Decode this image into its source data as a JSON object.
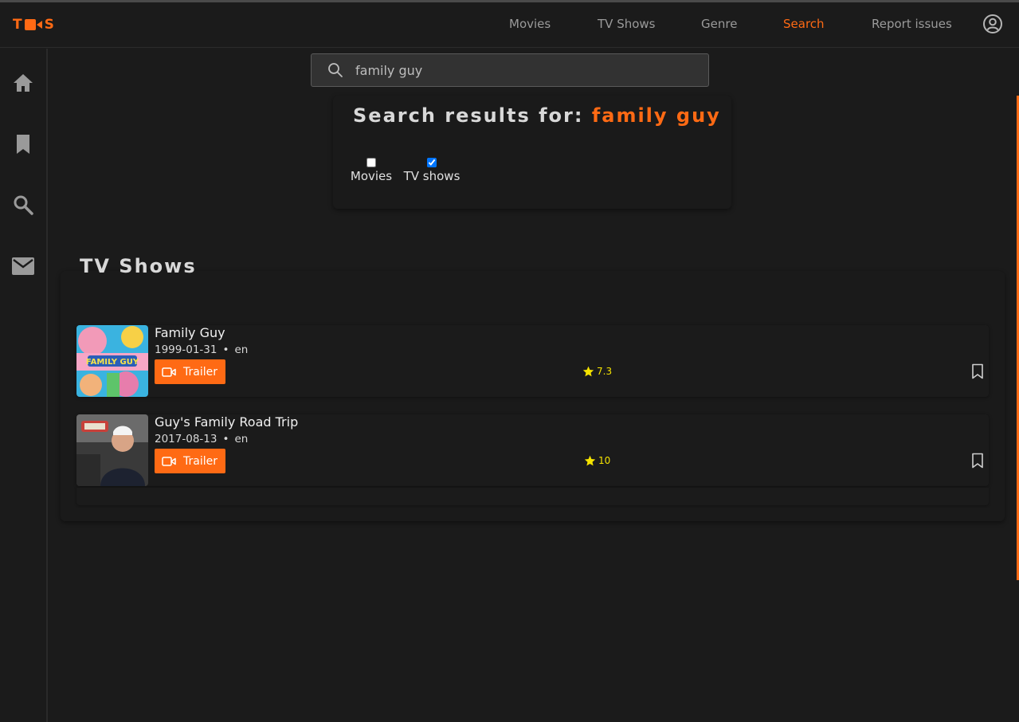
{
  "header": {
    "logo": {
      "left": "T",
      "right": "S",
      "icon": "camera-icon"
    },
    "nav": [
      {
        "label": "Movies",
        "active": false
      },
      {
        "label": "TV Shows",
        "active": false
      },
      {
        "label": "Genre",
        "active": false
      },
      {
        "label": "Search",
        "active": true
      },
      {
        "label": "Report issues",
        "active": false
      }
    ],
    "user_icon": "user-circle-icon"
  },
  "sidebar": {
    "items": [
      {
        "icon": "home-icon"
      },
      {
        "icon": "bookmark-icon"
      },
      {
        "icon": "search-icon"
      },
      {
        "icon": "mail-icon"
      }
    ]
  },
  "search": {
    "value": "family guy",
    "icon": "search-icon"
  },
  "results": {
    "prefix": "Search results for:",
    "query": "family guy",
    "filters": [
      {
        "label": "Movies",
        "checked": false
      },
      {
        "label": "TV shows",
        "checked": true
      }
    ]
  },
  "tv_section": {
    "title": "TV Shows",
    "items": [
      {
        "title": "Family Guy",
        "date": "1999-01-31",
        "lang": "en",
        "trailer": "Trailer",
        "rating": "7.3"
      },
      {
        "title": "Guy's Family Road Trip",
        "date": "2017-08-13",
        "lang": "en",
        "trailer": "Trailer",
        "rating": "10"
      }
    ]
  },
  "colors": {
    "accent": "#ff6a14",
    "background": "#1b1b1b",
    "rating": "#f5e300"
  }
}
